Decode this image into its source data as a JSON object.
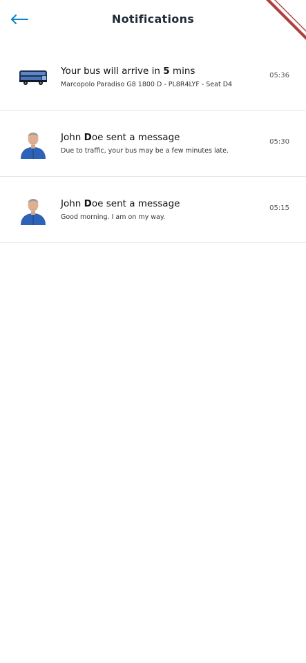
{
  "header": {
    "title": "Notifications",
    "back_icon": "arrow-left-icon",
    "accent_color": "#0b84c6"
  },
  "notifications": [
    {
      "icon": "bus-icon",
      "title_prefix": "Your bus will arrive in ",
      "title_emphasis": "5",
      "title_suffix": " mins",
      "subtitle": "Marcopolo Paradiso G8 1800 D - PL8R4LYF - Seat D4",
      "time": "05:36"
    },
    {
      "icon": "driver-avatar",
      "title_prefix": "John ",
      "title_emphasis": "D",
      "title_suffix": "oe sent a message",
      "subtitle": "Due to traffic, your bus may be a few minutes late.",
      "time": "05:30"
    },
    {
      "icon": "driver-avatar",
      "title_prefix": "John ",
      "title_emphasis": "D",
      "title_suffix": "oe sent a message",
      "subtitle": "Good morning. I am on my way.",
      "time": "05:15"
    }
  ]
}
